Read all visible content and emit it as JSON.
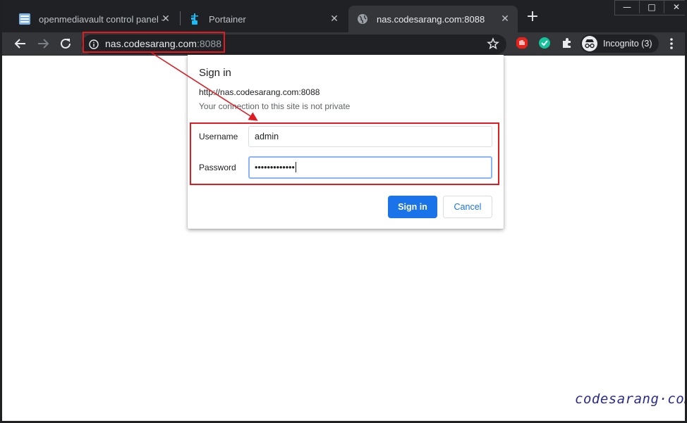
{
  "browser": {
    "tabs": [
      {
        "title": "openmediavault control panel - k",
        "favicon": "omv-icon",
        "active": false
      },
      {
        "title": "Portainer",
        "favicon": "portainer-icon",
        "active": false
      },
      {
        "title": "nas.codesarang.com:8088",
        "favicon": "globe-icon",
        "active": true
      }
    ],
    "window_controls": {
      "minimize": "—",
      "maximize": "□",
      "close": "✕"
    },
    "new_tab": "+",
    "close_glyph": "✕",
    "url_host": "nas.codesarang.com",
    "url_port": ":8088",
    "incognito_label": "Incognito (3)",
    "accent_red": "#e01b22"
  },
  "dialog": {
    "title": "Sign in",
    "url": "http://nas.codesarang.com:8088",
    "warning": "Your connection to this site is not private",
    "username_label": "Username",
    "username_value": "admin",
    "password_label": "Password",
    "password_value": "•••••••••••••",
    "signin_label": "Sign in",
    "cancel_label": "Cancel"
  },
  "watermark": "codesarang·com"
}
